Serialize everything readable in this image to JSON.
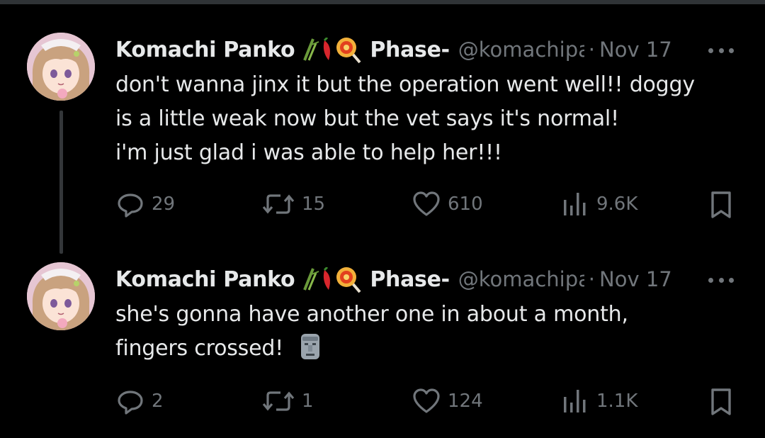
{
  "tweets": [
    {
      "name": "Komachi Panko",
      "name_suffix": "Phase-",
      "handle": "@komachipanko",
      "date": "Nov 17",
      "text_lines": [
        "don't wanna jinx it but the operation went well!! doggy",
        "is a little weak now but the vet says it's normal!",
        "i'm just glad i was able to help her!!!"
      ],
      "replies": "29",
      "reposts": "15",
      "likes": "610",
      "views": "9.6K"
    },
    {
      "name": "Komachi Panko",
      "name_suffix": "Phase-",
      "handle": "@komachipanko",
      "date": "Nov 17",
      "text_lines": [
        "she's gonna have another one in about a month,",
        "fingers crossed!"
      ],
      "replies": "2",
      "reposts": "1",
      "likes": "124",
      "views": "1.1K"
    }
  ],
  "icons": {
    "name_emojis": [
      "bamboo-icon",
      "chili-pepper-icon",
      "lollipop-icon"
    ],
    "tweet2_emoji": "moai-icon",
    "actions": [
      "reply-icon",
      "repost-icon",
      "like-icon",
      "views-icon",
      "bookmark-icon",
      "more-icon"
    ]
  },
  "colors": {
    "background": "#000000",
    "text": "#e7e9ea",
    "muted": "#71767b",
    "thread_line": "#333639"
  }
}
